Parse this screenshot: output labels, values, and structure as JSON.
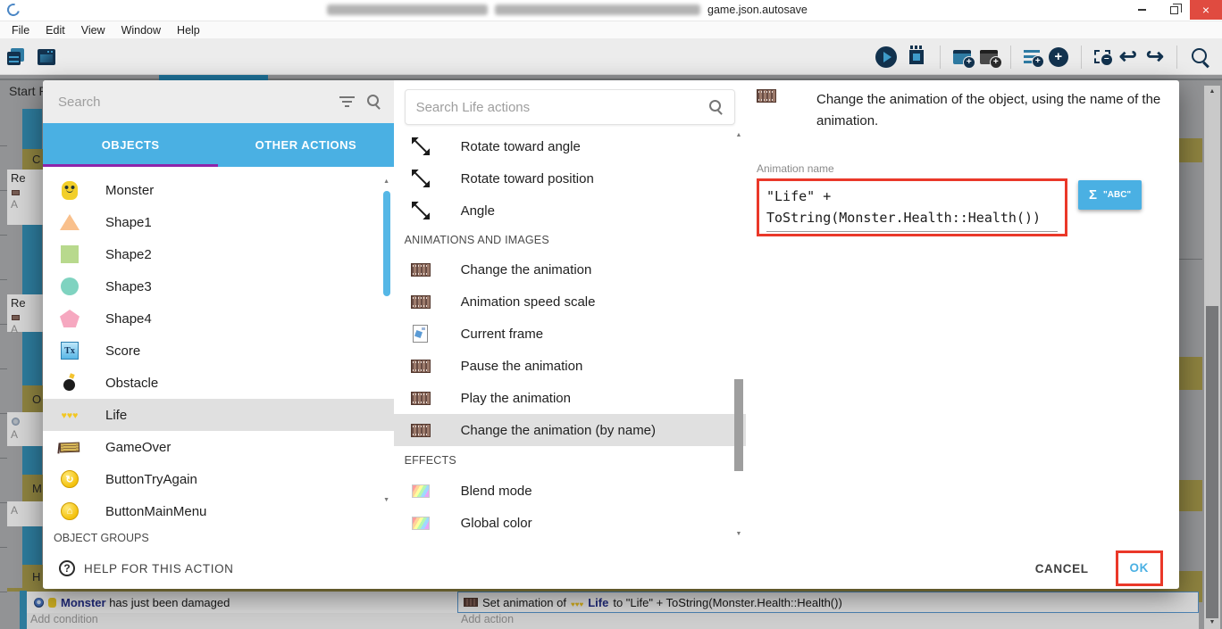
{
  "window": {
    "title": "game.json.autosave",
    "close_glyph": "×"
  },
  "menu": {
    "items": [
      "File",
      "Edit",
      "View",
      "Window",
      "Help"
    ]
  },
  "toolbar": {
    "left_icons": [
      "project-manager-icon",
      "start-page-icon"
    ],
    "right_icons": [
      "play-icon",
      "debug-icon",
      "sep",
      "add-event-icon",
      "add-comment-icon",
      "sep2",
      "add-subevent-icon",
      "add-circle-icon",
      "sep",
      "delete-event-icon",
      "undo-icon",
      "redo-icon",
      "sep",
      "search-tool-icon"
    ]
  },
  "background": {
    "tab_label": "Start P",
    "event_groups": [
      "C",
      "O",
      "M",
      "H"
    ],
    "row_snippets": [
      "Re",
      "Re"
    ],
    "add_snippets": [
      "A",
      "A",
      "A",
      "A"
    ],
    "bottom_event": {
      "condition_object": "Monster",
      "condition_text": "has just been damaged",
      "add_condition": "Add condition",
      "action_before": "Set animation of",
      "action_object": "Life",
      "action_after": "to \"Life\" + ToString(Monster.Health::Health())",
      "add_action": "Add action"
    }
  },
  "dialog": {
    "left": {
      "search_placeholder": "Search",
      "tabs": [
        {
          "label": "OBJECTS",
          "active": true
        },
        {
          "label": "OTHER ACTIONS",
          "active": false
        }
      ],
      "objects": [
        {
          "name": "Monster",
          "icon": "monster-icon"
        },
        {
          "name": "Shape1",
          "icon": "triangle-icon"
        },
        {
          "name": "Shape2",
          "icon": "square-icon"
        },
        {
          "name": "Shape3",
          "icon": "circle-icon"
        },
        {
          "name": "Shape4",
          "icon": "pentagon-icon"
        },
        {
          "name": "Score",
          "icon": "text-icon"
        },
        {
          "name": "Obstacle",
          "icon": "bomb-icon"
        },
        {
          "name": "Life",
          "icon": "hearts-icon",
          "selected": true
        },
        {
          "name": "GameOver",
          "icon": "banner-icon"
        },
        {
          "name": "ButtonTryAgain",
          "icon": "retry-button-icon"
        },
        {
          "name": "ButtonMainMenu",
          "icon": "home-button-icon"
        }
      ],
      "group_header": "OBJECT GROUPS"
    },
    "middle": {
      "search_placeholder": "Search Life actions",
      "items": [
        {
          "type": "item",
          "icon": "rotate-icon",
          "label": "Rotate toward angle"
        },
        {
          "type": "item",
          "icon": "rotate-icon",
          "label": "Rotate toward position"
        },
        {
          "type": "item",
          "icon": "rotate-icon",
          "label": "Angle"
        },
        {
          "type": "header",
          "label": "ANIMATIONS AND IMAGES"
        },
        {
          "type": "item",
          "icon": "film-icon",
          "label": "Change the animation"
        },
        {
          "type": "item",
          "icon": "film-icon",
          "label": "Animation speed scale"
        },
        {
          "type": "item",
          "icon": "frame-icon",
          "label": "Current frame"
        },
        {
          "type": "item",
          "icon": "film-icon",
          "label": "Pause the animation"
        },
        {
          "type": "item",
          "icon": "film-icon",
          "label": "Play the animation"
        },
        {
          "type": "item",
          "icon": "film-icon",
          "label": "Change the animation (by name)",
          "selected": true
        },
        {
          "type": "header",
          "label": "EFFECTS"
        },
        {
          "type": "item",
          "icon": "color-icon",
          "label": "Blend mode"
        },
        {
          "type": "item",
          "icon": "color-icon",
          "label": "Global color"
        }
      ]
    },
    "right": {
      "description": "Change the animation of the object, using the name of the animation.",
      "field_label": "Animation name",
      "value_line1": "\"Life\" +",
      "value_line2": "ToString(Monster.Health::Health())",
      "expr_button_sigma": "Σ",
      "expr_button_label": "\"ABC\""
    },
    "footer": {
      "help": "HELP FOR THIS ACTION",
      "cancel": "CANCEL",
      "ok": "OK"
    }
  },
  "colors": {
    "accent_blue": "#4ab0e3",
    "tab_underline_purple": "#8e24aa",
    "annotation_red": "#ea3829",
    "toolbar_navy": "#12324e"
  }
}
